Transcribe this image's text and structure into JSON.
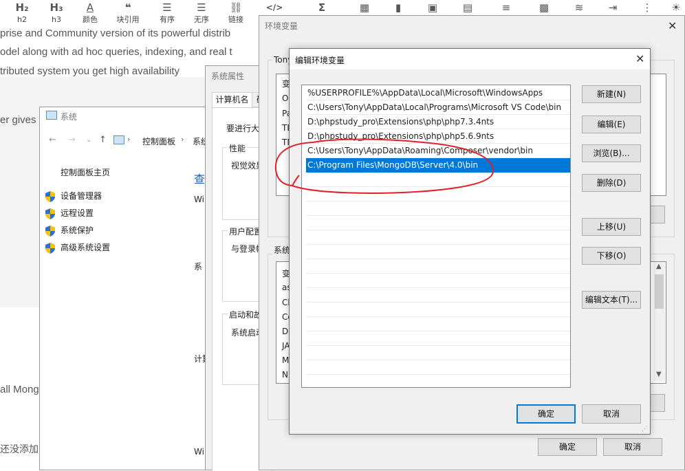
{
  "toolbar": {
    "items": [
      {
        "icon": "H₂",
        "label": "h2"
      },
      {
        "icon": "H₃",
        "label": "h3"
      },
      {
        "icon": "A",
        "label": "颜色"
      },
      {
        "icon": "❝",
        "label": "块引用"
      },
      {
        "icon": "☰",
        "label": "有序"
      },
      {
        "icon": "☰",
        "label": "无序"
      },
      {
        "icon": "⛓",
        "label": "链接"
      },
      {
        "icon": "</>",
        "label": ""
      },
      {
        "icon": "Σ",
        "label": ""
      },
      {
        "icon": "▦",
        "label": ""
      },
      {
        "icon": "▮",
        "label": ""
      },
      {
        "icon": "▣",
        "label": ""
      },
      {
        "icon": "▤",
        "label": ""
      },
      {
        "icon": "≡",
        "label": ""
      },
      {
        "icon": "▩",
        "label": ""
      },
      {
        "icon": "≋",
        "label": ""
      },
      {
        "icon": "⇥",
        "label": ""
      },
      {
        "icon": "⋮",
        "label": ""
      },
      {
        "icon": "☀",
        "label": ""
      }
    ]
  },
  "background": {
    "line1": "prise and Community version of its powerful distrib",
    "line2": "odel along with ad hoc queries, indexing, and real t",
    "line3": "tributed system you get high availability",
    "line4": "er gives",
    "line5": "all Mong",
    "line6": "还没添加"
  },
  "system_window": {
    "title": "系统",
    "breadcrumb": [
      "控制面板",
      "系统"
    ],
    "home_link": "控制面板主页",
    "items": [
      "设备管理器",
      "远程设置",
      "系统保护",
      "高级系统设置"
    ],
    "main_heading": "查",
    "labels": [
      "Wi",
      "系",
      "计算",
      "Wi"
    ]
  },
  "sysprops_window": {
    "title": "系统属性",
    "tabs": [
      "计算机名",
      "硬"
    ],
    "intro": "要进行大",
    "perf_group": "性能",
    "perf_text": "视觉效果",
    "profile_group": "用户配置",
    "profile_text": "与登录帐",
    "startup_group": "启动和故",
    "startup_text": "系统启动"
  },
  "envvars_window": {
    "title": "环境变量",
    "user_group": "Tony",
    "user_vars": [
      "变",
      "On",
      "Pa",
      "TE",
      "TM"
    ],
    "system_group": "系统",
    "system_vars": [
      "变",
      "as",
      "Cl",
      "Co",
      "Dr",
      "JA",
      "M",
      "NU"
    ],
    "ok_label": "确定",
    "cancel_label": "取消"
  },
  "edit_dialog": {
    "title": "编辑环境变量",
    "paths": [
      "%USERPROFILE%\\AppData\\Local\\Microsoft\\WindowsApps",
      "C:\\Users\\Tony\\AppData\\Local\\Programs\\Microsoft VS Code\\bin",
      "D:\\phpstudy_pro\\Extensions\\php\\php7.3.4nts",
      "D:\\phpstudy_pro\\Extensions\\php\\php5.6.9nts",
      "C:\\Users\\Tony\\AppData\\Roaming\\Composer\\vendor\\bin",
      "C:\\Program Files\\MongoDB\\Server\\4.0\\bin"
    ],
    "selected_index": 5,
    "buttons": {
      "new": "新建(N)",
      "edit": "编辑(E)",
      "browse": "浏览(B)...",
      "delete": "删除(D)",
      "move_up": "上移(U)",
      "move_down": "下移(O)",
      "edit_text": "编辑文本(T)..."
    },
    "ok_label": "确定",
    "cancel_label": "取消"
  },
  "colors": {
    "selection": "#0078d7",
    "annotation": "#e0202a"
  }
}
